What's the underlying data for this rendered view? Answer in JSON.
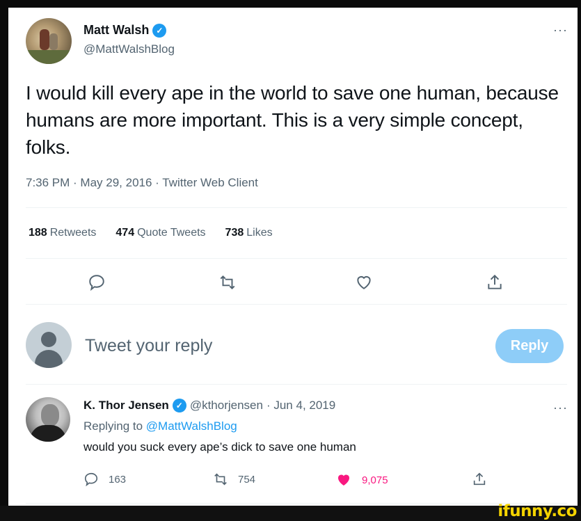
{
  "tweet": {
    "author": {
      "name": "Matt Walsh",
      "handle": "@MattWalshBlog",
      "verified": true
    },
    "text": "I would kill every ape in the world to save one human, because humans are more important. This is a very simple concept, folks.",
    "meta": "7:36 PM · May 29, 2016 · Twitter Web Client",
    "stats": [
      {
        "count": "188",
        "label": "Retweets"
      },
      {
        "count": "474",
        "label": "Quote Tweets"
      },
      {
        "count": "738",
        "label": "Likes"
      }
    ],
    "actions": [
      "reply-icon",
      "retweet-icon",
      "like-icon",
      "share-icon"
    ],
    "more": "···"
  },
  "composer": {
    "placeholder": "Tweet your reply",
    "button_label": "Reply"
  },
  "reply": {
    "author": {
      "name": "K. Thor Jensen",
      "handle": "@kthorjensen",
      "verified": true
    },
    "date": "· Jun 4, 2019",
    "replying_prefix": "Replying to",
    "replying_mention": "@MattWalshBlog",
    "text": "would you suck every ape’s dick to save one human",
    "counts": {
      "replies": "163",
      "retweets": "754",
      "likes": "9,075"
    },
    "more": "···"
  },
  "watermark": "ifunny.co",
  "colors": {
    "accent": "#1d9bf0",
    "like": "#f91880",
    "muted": "#536471",
    "reply_button": "#8ecdf8"
  }
}
